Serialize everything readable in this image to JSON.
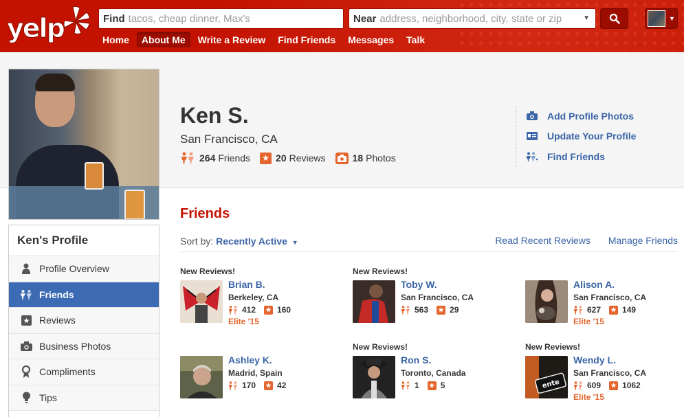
{
  "header": {
    "logo_text": "yelp",
    "find_label": "Find",
    "find_placeholder": "tacos, cheap dinner, Max's",
    "near_label": "Near",
    "near_placeholder": "address, neighborhood, city, state or zip",
    "nav": [
      "Home",
      "About Me",
      "Write a Review",
      "Find Friends",
      "Messages",
      "Talk"
    ],
    "active_nav": "About Me"
  },
  "profile": {
    "name": "Ken S.",
    "location": "San Francisco, CA",
    "friends_count": "264",
    "friends_label": "Friends",
    "reviews_count": "20",
    "reviews_label": "Reviews",
    "photos_count": "18",
    "photos_label": "Photos",
    "actions": [
      "Add Profile Photos",
      "Update Your Profile",
      "Find Friends"
    ]
  },
  "sidebar": {
    "title": "Ken's Profile",
    "items": [
      "Profile Overview",
      "Friends",
      "Reviews",
      "Business Photos",
      "Compliments",
      "Tips"
    ],
    "active_item": "Friends"
  },
  "friends_section": {
    "title": "Friends",
    "sort_label": "Sort by:",
    "sort_value": "Recently Active",
    "links": [
      "Read Recent Reviews",
      "Manage Friends"
    ],
    "friends": [
      {
        "badge": "New Reviews!",
        "name": "Brian B.",
        "location": "Berkeley, CA",
        "friends": "412",
        "reviews": "160",
        "elite": "Elite '15"
      },
      {
        "badge": "New Reviews!",
        "name": "Toby W.",
        "location": "San Francisco, CA",
        "friends": "563",
        "reviews": "29",
        "elite": ""
      },
      {
        "badge": "",
        "name": "Alison A.",
        "location": "San Francisco, CA",
        "friends": "627",
        "reviews": "149",
        "elite": "Elite '15"
      },
      {
        "badge": "",
        "name": "Ashley K.",
        "location": "Madrid, Spain",
        "friends": "170",
        "reviews": "42",
        "elite": ""
      },
      {
        "badge": "New Reviews!",
        "name": "Ron S.",
        "location": "Toronto, Canada",
        "friends": "1",
        "reviews": "5",
        "elite": ""
      },
      {
        "badge": "New Reviews!",
        "name": "Wendy L.",
        "location": "San Francisco, CA",
        "friends": "609",
        "reviews": "1062",
        "elite": "Elite '15"
      }
    ]
  },
  "colors": {
    "brand_red": "#c41200",
    "link_blue": "#3b65a7",
    "accent_orange": "#e4662e",
    "sidebar_active": "#3d6bb3"
  }
}
